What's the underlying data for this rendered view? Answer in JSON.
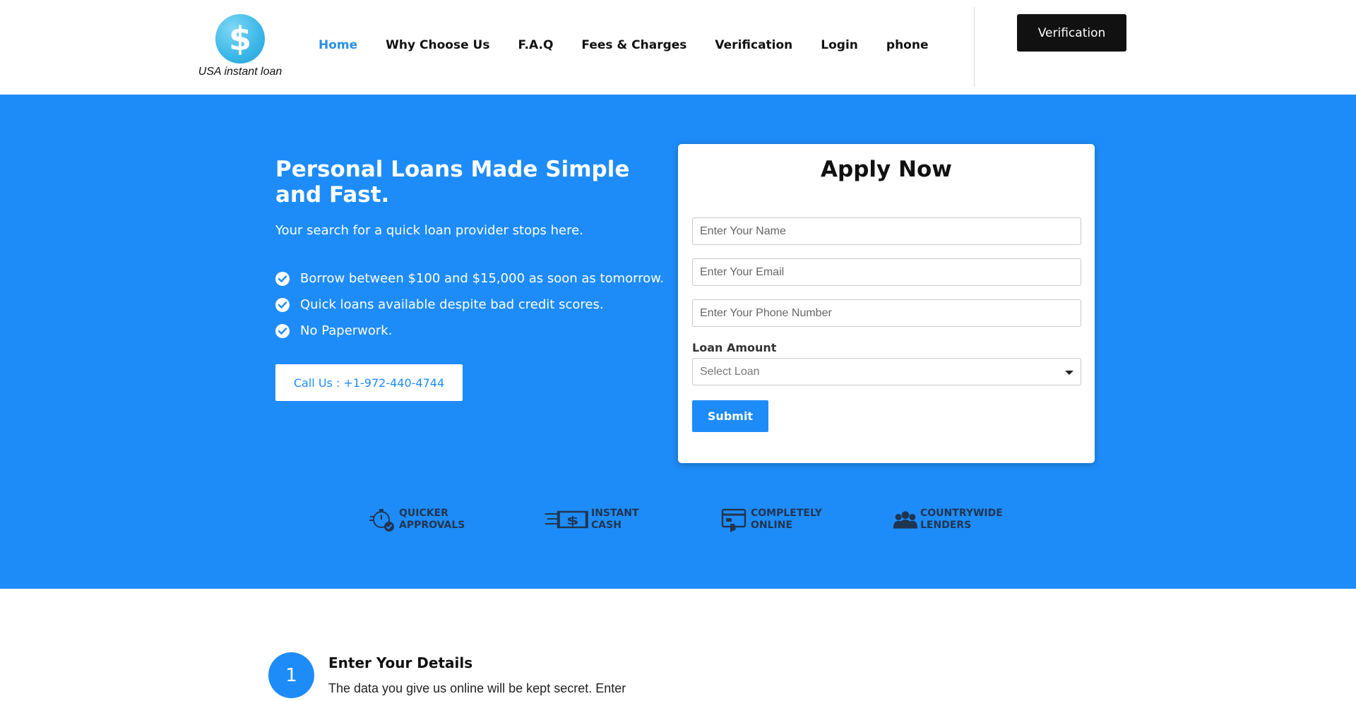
{
  "header": {
    "logo_symbol": "$",
    "logo_text": "USA instant loan",
    "nav": [
      {
        "label": "Home",
        "active": true
      },
      {
        "label": "Why Choose Us"
      },
      {
        "label": "F.A.Q"
      },
      {
        "label": "Fees & Charges"
      },
      {
        "label": "Verification"
      },
      {
        "label": "Login"
      },
      {
        "label": "phone"
      }
    ],
    "verification_button": "Verification"
  },
  "hero": {
    "title": "Personal Loans Made Simple and Fast.",
    "subtitle": "Your search for a quick loan provider stops here.",
    "bullets": [
      "Borrow between $100 and $15,000 as soon as tomorrow.",
      "Quick loans available despite bad credit scores.",
      "No Paperwork."
    ],
    "call_button": "Call Us : +1-972-440-4744",
    "bg_color": "#1e8cf8"
  },
  "form": {
    "title": "Apply Now",
    "name_placeholder": "Enter Your Name",
    "email_placeholder": "Enter Your Email",
    "phone_placeholder": "Enter Your Phone Number",
    "loan_label": "Loan Amount",
    "loan_select_value": "Select Loan",
    "submit_label": "Submit"
  },
  "features": [
    {
      "line1": "Quicker",
      "line2": "Approvals",
      "icon": "stopwatch-check-icon"
    },
    {
      "line1": "Instant",
      "line2": "Cash",
      "icon": "cash-icon"
    },
    {
      "line1": "Completely",
      "line2": "Online",
      "icon": "online-payment-icon"
    },
    {
      "line1": "Countrywide",
      "line2": "Lenders",
      "icon": "people-group-icon"
    }
  ],
  "steps": [
    {
      "number": "1",
      "title": "Enter Your Details",
      "text": "The data you give us online will be kept secret. Enter"
    }
  ]
}
